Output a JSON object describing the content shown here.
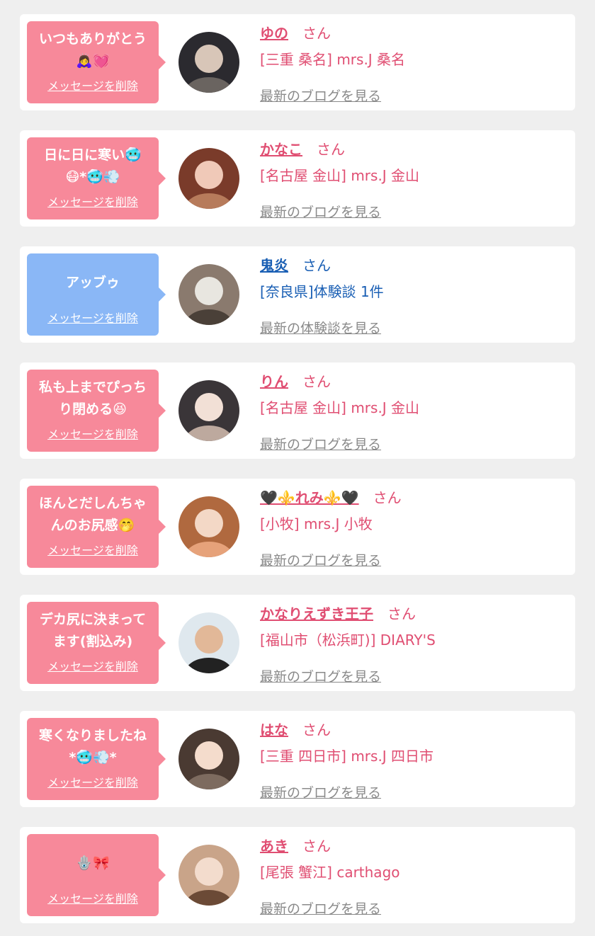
{
  "common": {
    "delete_label": "メッセージを削除",
    "san_label": "さん",
    "blog_label": "最新のブログを見る"
  },
  "cards": [
    {
      "message": "いつもありがとう\n🙇‍♀️💓",
      "bubble_color": "pink",
      "name": "ゆの",
      "shop": "[三重 桑名] mrs.J 桑名",
      "link_label": "最新のブログを見る",
      "avatar_tones": [
        "#2b2a2f",
        "#d8c6b8",
        "#6a6460"
      ]
    },
    {
      "message": "日に日に寒い🥶\n😷*🥶💨",
      "bubble_color": "pink",
      "name": "かなこ",
      "shop": "[名古屋 金山] mrs.J 金山",
      "link_label": "最新のブログを見る",
      "avatar_tones": [
        "#7a3b2a",
        "#f0c9b8",
        "#b77b5b"
      ]
    },
    {
      "message": "アッブゥ",
      "bubble_color": "blue",
      "name": "鬼炎",
      "shop": "[奈良県]体験談 1件",
      "link_label": "最新の体験談を見る",
      "avatar_tones": [
        "#8a7a6e",
        "#e8e6e0",
        "#4a4038"
      ]
    },
    {
      "message": "私も上までぴっち\nり閉める😆",
      "bubble_color": "pink",
      "name": "りん",
      "shop": "[名古屋 金山] mrs.J 金山",
      "link_label": "最新のブログを見る",
      "avatar_tones": [
        "#3a3538",
        "#f2e0d6",
        "#bda99e"
      ]
    },
    {
      "message": "ほんとだしんちゃ\nんのお尻感🤭",
      "bubble_color": "pink",
      "name": "🖤⚜️れみ⚜️🖤",
      "shop": "[小牧] mrs.J 小牧",
      "link_label": "最新のブログを見る",
      "avatar_tones": [
        "#b0693f",
        "#f3d8c6",
        "#e6a27a"
      ]
    },
    {
      "message": "デカ尻に決まって\nます(割込み)",
      "bubble_color": "pink",
      "name": "かなりえずき王子",
      "shop": "[福山市（松浜町)] DIARY'S",
      "link_label": "最新のブログを見る",
      "avatar_tones": [
        "#dfe8ee",
        "#e2b898",
        "#222222"
      ]
    },
    {
      "message": "寒くなりましたね\n*🥶💨*",
      "bubble_color": "pink",
      "name": "はな",
      "shop": "[三重 四日市] mrs.J 四日市",
      "link_label": "最新のブログを見る",
      "avatar_tones": [
        "#4a3a32",
        "#f4dccc",
        "#7d6b5f"
      ]
    },
    {
      "message": "🪬🎀",
      "bubble_color": "pink",
      "name": "あき",
      "shop": "[尾張 蟹江] carthago",
      "link_label": "最新のブログを見る",
      "avatar_tones": [
        "#c9a489",
        "#f3dccd",
        "#6b4a36"
      ]
    }
  ]
}
